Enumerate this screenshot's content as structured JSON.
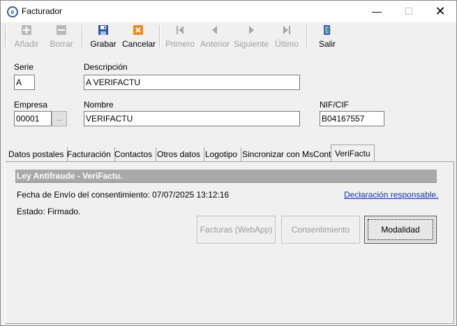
{
  "window": {
    "title": "Facturador",
    "minimize_glyph": "—",
    "maximize_glyph": "☐",
    "close_glyph": "✕"
  },
  "toolbar": {
    "add": "Añadir",
    "delete": "Borrar",
    "save": "Grabar",
    "cancel": "Cancelar",
    "first": "Primero",
    "previous": "Anterior",
    "next": "Siguiente",
    "last": "Último",
    "exit": "Salir"
  },
  "form": {
    "serie_label": "Serie",
    "serie_value": "A",
    "descripcion_label": "Descripción",
    "descripcion_value": "A VERIFACTU",
    "empresa_label": "Empresa",
    "empresa_value": "00001",
    "empresa_button": "...",
    "nombre_label": "Nombre",
    "nombre_value": "VERIFACTU",
    "nif_label": "NIF/CIF",
    "nif_value": "B04167557"
  },
  "tabs": [
    "Datos postales",
    "Facturación",
    "Contactos",
    "Otros datos",
    "Logotipo",
    "Sincronizar con MsConta",
    "VeriFactu"
  ],
  "verifactu": {
    "section_title": "Ley Antifraude - VeriFactu.",
    "fecha_envio": "Fecha de Envío del consentimiento: 07/07/2025 13:12:16",
    "declaracion_link": "Declaración responsable.",
    "estado": "Estado: Firmado.",
    "btn_facturas": "Facturas (WebApp)",
    "btn_consentimiento": "Consentimiento",
    "btn_modalidad": "Modalidad"
  },
  "colors": {
    "accent_link": "#0b2fbf",
    "section_bar": "#a9a9a9"
  }
}
